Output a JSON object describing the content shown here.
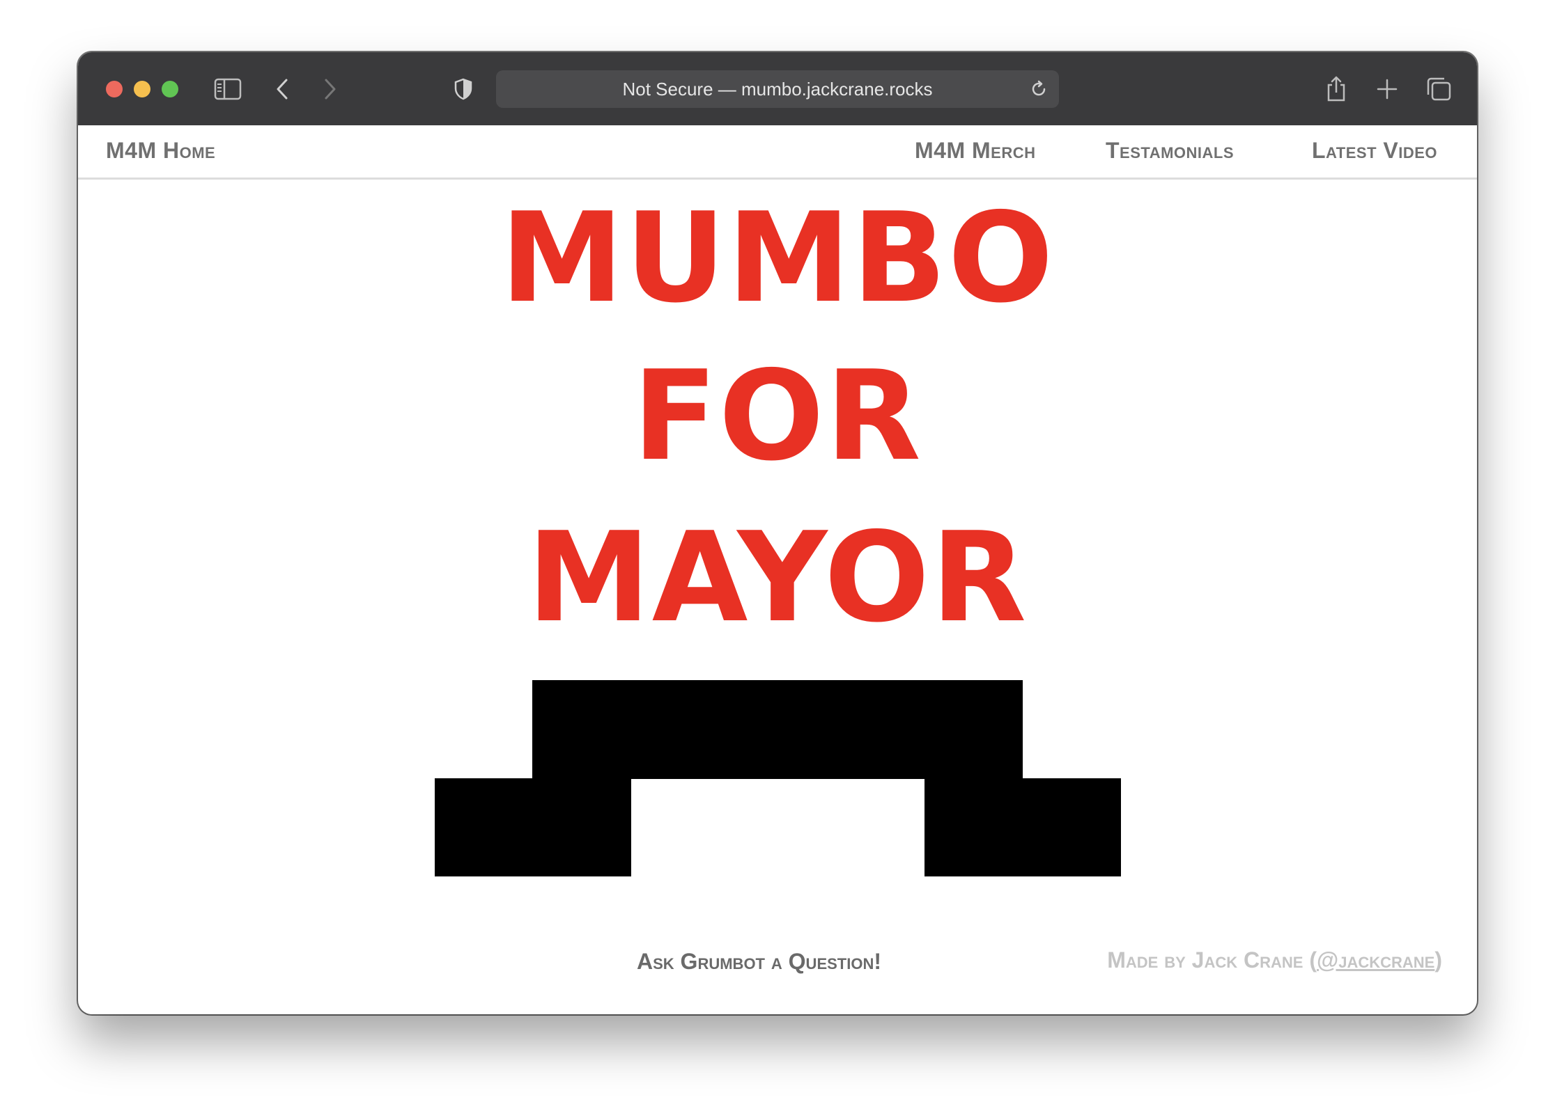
{
  "browser": {
    "url_text": "Not Secure — mumbo.jackcrane.rocks",
    "icons": [
      "sidebar-icon",
      "back-icon",
      "forward-icon",
      "shield-icon",
      "reload-icon",
      "share-icon",
      "new-tab-icon",
      "tabs-overview-icon"
    ]
  },
  "nav": {
    "home": "M4M Home",
    "merch": "M4M Merch",
    "testimonials": "Testamonials",
    "latest_video": "Latest Video"
  },
  "hero": {
    "line1": "MUMBO",
    "line2": "FOR",
    "line3": "MAYOR"
  },
  "footer": {
    "ask": "Ask Grumbot a Question!",
    "credit_prefix": "Made by Jack Crane (",
    "credit_handle": "@jackcrane",
    "credit_suffix": ")"
  },
  "colors": {
    "headline": "#e83124",
    "nav_text": "#707070",
    "titlebar": "#3a3a3c",
    "mustache": "#000000"
  }
}
